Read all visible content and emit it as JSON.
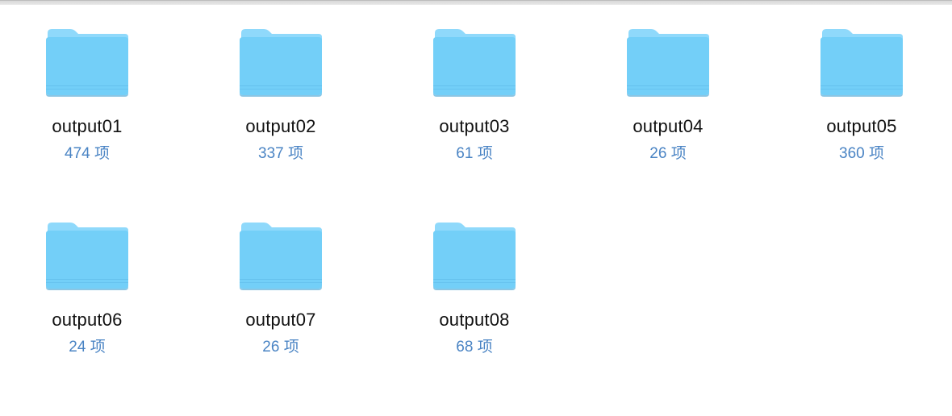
{
  "colors": {
    "folder_front": "#73cff8",
    "folder_back": "#8fd9fb",
    "count_text": "#4a84c4",
    "name_text": "#111111"
  },
  "folders": [
    {
      "name": "output01",
      "count": "474 项",
      "icon": "folder-icon"
    },
    {
      "name": "output02",
      "count": "337 项",
      "icon": "folder-icon"
    },
    {
      "name": "output03",
      "count": "61 项",
      "icon": "folder-icon"
    },
    {
      "name": "output04",
      "count": "26 项",
      "icon": "folder-icon"
    },
    {
      "name": "output05",
      "count": "360 项",
      "icon": "folder-icon"
    },
    {
      "name": "output06",
      "count": "24 项",
      "icon": "folder-icon"
    },
    {
      "name": "output07",
      "count": "26 项",
      "icon": "folder-icon"
    },
    {
      "name": "output08",
      "count": "68 项",
      "icon": "folder-icon"
    }
  ]
}
